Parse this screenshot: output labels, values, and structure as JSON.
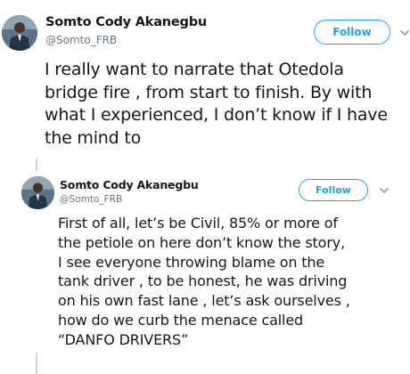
{
  "tweets": [
    {
      "name": "Somto Cody Akanegbu",
      "handle": "@Somto_FRB",
      "follow_label": "Follow",
      "text": "I really want to narrate that Otedola\nbridge fire , from start to finish. By with\nwhat I experienced, I don’t know if I have\nthe mind to"
    },
    {
      "name": "Somto Cody Akanegbu",
      "handle": "@Somto_FRB",
      "follow_label": "Follow",
      "text": "First of all, let’s be Civil, 85% or more of\nthe petiole on here don’t know the story,\nI see everyone throwing blame on the\ntank driver , to be honest, he was driving\non his own fast lane , let’s ask ourselves ,\nhow do we curb the menace called\n“DANFO DRIVERS”"
    }
  ],
  "colors": {
    "accent": "#1da1f2",
    "text": "#14171a",
    "secondary": "#657786",
    "thread": "#ccd6dd"
  },
  "icons": [
    "avatar-photo",
    "chevron-down-icon"
  ]
}
